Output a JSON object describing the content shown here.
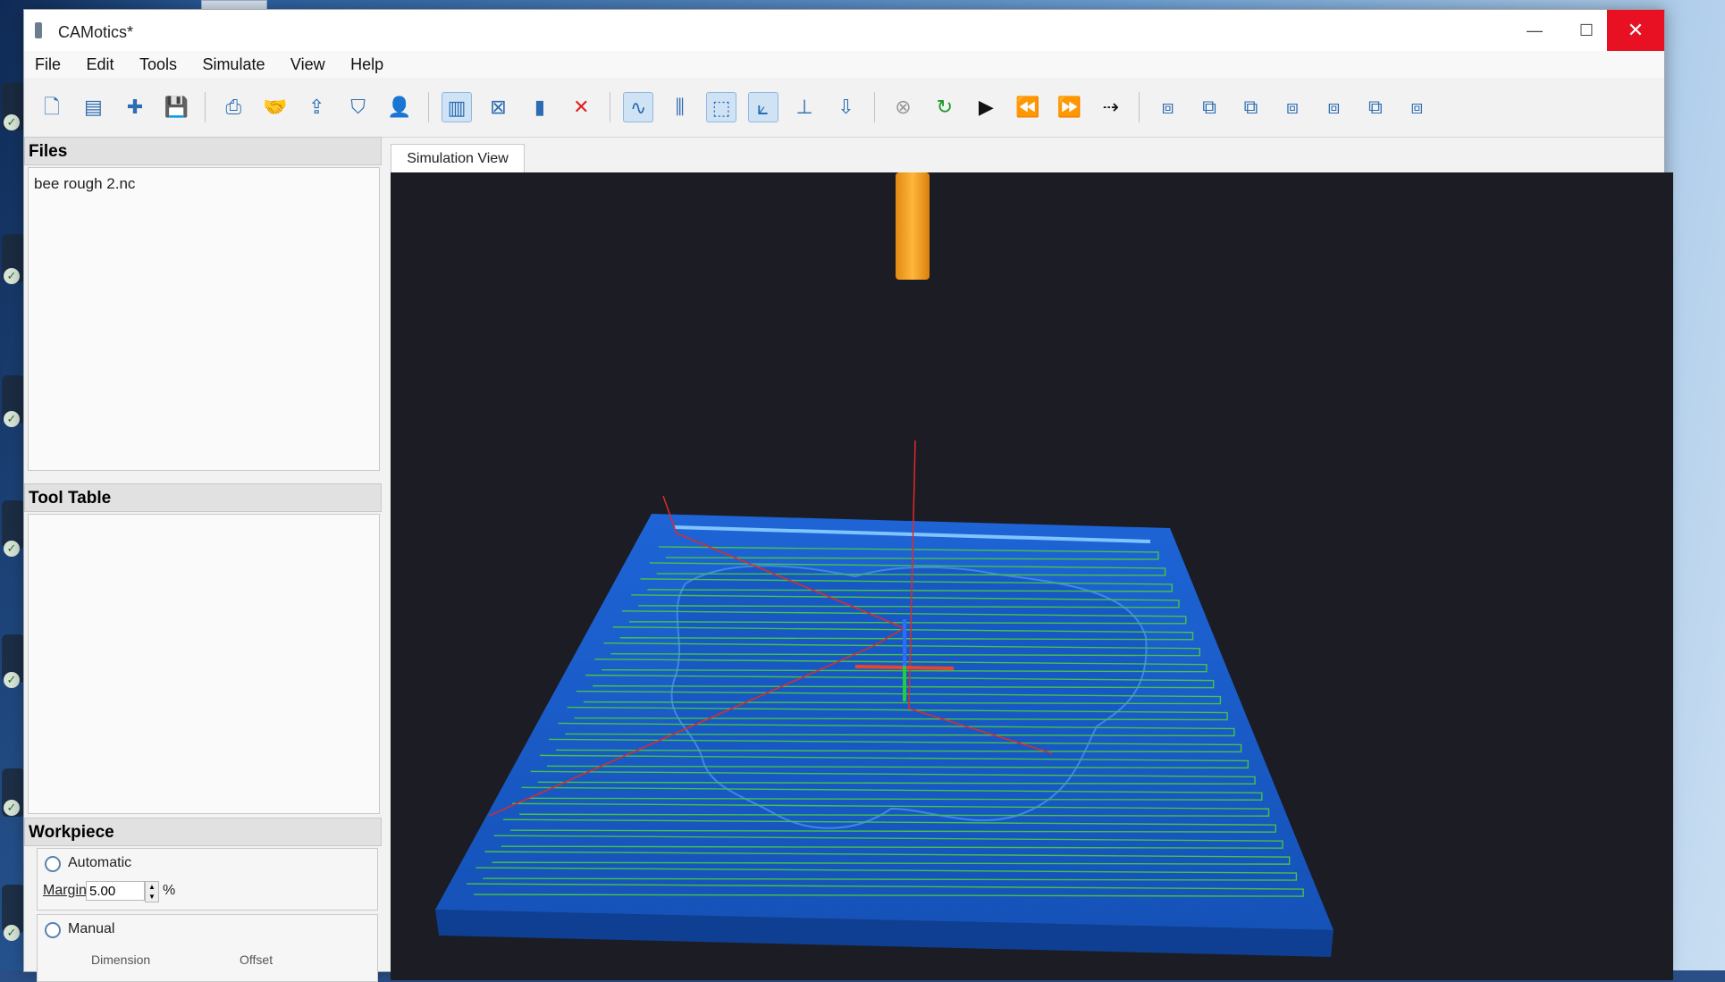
{
  "app": {
    "title": "CAMotics*"
  },
  "window_controls": {
    "minimize": "—",
    "maximize": "☐",
    "close": "✕"
  },
  "menu": [
    "File",
    "Edit",
    "Tools",
    "Simulate",
    "View",
    "Help"
  ],
  "toolbar": {
    "groups": [
      [
        "new-project-icon",
        "open-project-icon",
        "add-file-icon",
        "save-icon"
      ],
      [
        "export-icon",
        "handshake-icon",
        "upload-icon",
        "shield-icon",
        "user-icon"
      ],
      [
        "tool-path-icon",
        "workpiece-icon",
        "tool-icon",
        "close-view-icon"
      ],
      [
        "curve-path-icon",
        "tool-holder-icon",
        "bounding-box-icon",
        "axes-icon",
        "surface-icon",
        "spindle-icon"
      ],
      [
        "stop-icon",
        "rerun-icon",
        "play-icon",
        "rewind-icon",
        "fast-forward-icon",
        "step-icon"
      ],
      [
        "view-iso-icon",
        "view-front-icon",
        "view-back-icon",
        "view-left-icon",
        "view-right-icon",
        "view-top-icon",
        "view-bottom-icon"
      ]
    ]
  },
  "files": {
    "title": "Files",
    "items": [
      "bee rough 2.nc"
    ]
  },
  "tool_table": {
    "title": "Tool Table"
  },
  "workpiece": {
    "title": "Workpiece",
    "automatic_label": "Automatic",
    "margin_label": "Margin",
    "margin_value": "5.00",
    "margin_unit": "%",
    "manual_label": "Manual",
    "dimension_header": "Dimension",
    "offset_header": "Offset"
  },
  "simulation": {
    "tab_label": "Simulation View"
  },
  "colors": {
    "background": "#1b1c24",
    "workpiece": "#1a5fd0",
    "toolpath_cut": "#44c24a",
    "toolpath_rapid": "#e02a2a",
    "tool": "#f5a623",
    "close_button": "#e81123"
  }
}
